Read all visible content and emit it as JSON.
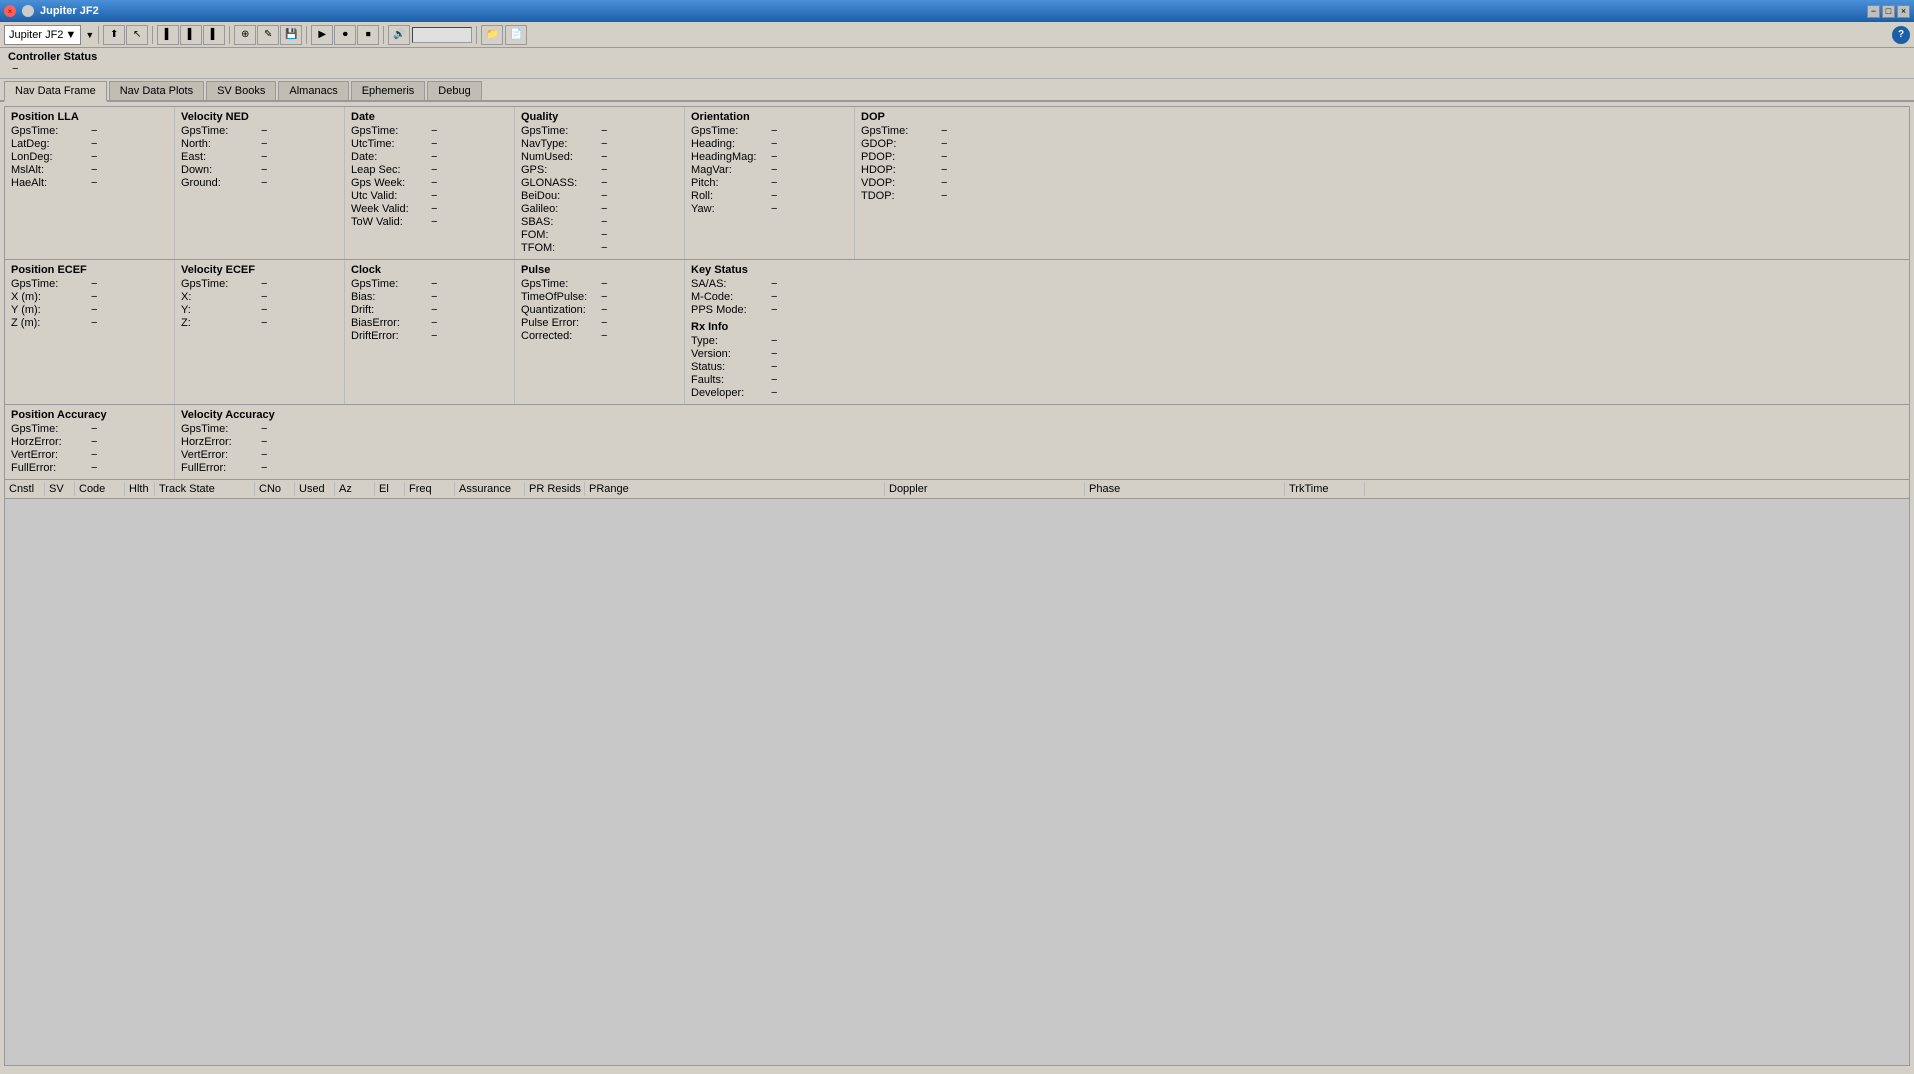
{
  "window": {
    "title": "Jupiter JF2",
    "close_label": "×",
    "minimize_label": "−",
    "maximize_label": "□"
  },
  "device": {
    "name": "Jupiter JF2",
    "dropdown_arrow": "▼"
  },
  "toolbar": {
    "help": "?"
  },
  "controller_status": {
    "label": "Controller Status",
    "value": "−"
  },
  "tabs": [
    {
      "label": "Nav Data Frame",
      "active": true
    },
    {
      "label": "Nav Data Plots",
      "active": false
    },
    {
      "label": "SV Books",
      "active": false
    },
    {
      "label": "Almanacs",
      "active": false
    },
    {
      "label": "Ephemeris",
      "active": false
    },
    {
      "label": "Debug",
      "active": false
    }
  ],
  "panels": {
    "position_lla": {
      "title": "Position LLA",
      "fields": [
        {
          "label": "GpsTime:",
          "value": "−"
        },
        {
          "label": "LatDeg:",
          "value": "−"
        },
        {
          "label": "LonDeg:",
          "value": "−"
        },
        {
          "label": "MslAlt:",
          "value": "−"
        },
        {
          "label": "HaeAlt:",
          "value": "−"
        }
      ]
    },
    "velocity_ned": {
      "title": "Velocity NED",
      "fields": [
        {
          "label": "GpsTime:",
          "value": "−"
        },
        {
          "label": "North:",
          "value": "−"
        },
        {
          "label": "East:",
          "value": "−"
        },
        {
          "label": "Down:",
          "value": "−"
        },
        {
          "label": "Ground:",
          "value": "−"
        }
      ]
    },
    "date": {
      "title": "Date",
      "fields": [
        {
          "label": "GpsTime:",
          "value": "−"
        },
        {
          "label": "UtcTime:",
          "value": "−"
        },
        {
          "label": "Date:",
          "value": "−"
        },
        {
          "label": "Leap Sec:",
          "value": "−"
        },
        {
          "label": "Gps Week:",
          "value": "−"
        },
        {
          "label": "Utc Valid:",
          "value": "−"
        },
        {
          "label": "Week Valid:",
          "value": "−"
        },
        {
          "label": "ToW Valid:",
          "value": "−"
        }
      ]
    },
    "quality": {
      "title": "Quality",
      "fields": [
        {
          "label": "GpsTime:",
          "value": "−"
        },
        {
          "label": "NavType:",
          "value": "−"
        },
        {
          "label": "NumUsed:",
          "value": "−"
        },
        {
          "label": "GPS:",
          "value": "−"
        },
        {
          "label": "GLONASS:",
          "value": "−"
        },
        {
          "label": "BeiDou:",
          "value": "−"
        },
        {
          "label": "Galileo:",
          "value": "−"
        },
        {
          "label": "SBAS:",
          "value": "−"
        },
        {
          "label": "FOM:",
          "value": "−"
        },
        {
          "label": "TFOM:",
          "value": "−"
        }
      ]
    },
    "orientation": {
      "title": "Orientation",
      "fields": [
        {
          "label": "GpsTime:",
          "value": "−"
        },
        {
          "label": "Heading:",
          "value": "−"
        },
        {
          "label": "HeadingMag:",
          "value": "−"
        },
        {
          "label": "MagVar:",
          "value": "−"
        },
        {
          "label": "Pitch:",
          "value": "−"
        },
        {
          "label": "Roll:",
          "value": "−"
        },
        {
          "label": "Yaw:",
          "value": "−"
        }
      ]
    },
    "dop": {
      "title": "DOP",
      "fields": [
        {
          "label": "GpsTime:",
          "value": "−"
        },
        {
          "label": "GDOP:",
          "value": "−"
        },
        {
          "label": "PDOP:",
          "value": "−"
        },
        {
          "label": "HDOP:",
          "value": "−"
        },
        {
          "label": "VDOP:",
          "value": "−"
        },
        {
          "label": "TDOP:",
          "value": "−"
        }
      ]
    },
    "position_ecef": {
      "title": "Position ECEF",
      "fields": [
        {
          "label": "GpsTime:",
          "value": "−"
        },
        {
          "label": "X (m):",
          "value": "−"
        },
        {
          "label": "Y (m):",
          "value": "−"
        },
        {
          "label": "Z (m):",
          "value": "−"
        }
      ]
    },
    "velocity_ecef": {
      "title": "Velocity ECEF",
      "fields": [
        {
          "label": "GpsTime:",
          "value": "−"
        },
        {
          "label": "X:",
          "value": "−"
        },
        {
          "label": "Y:",
          "value": "−"
        },
        {
          "label": "Z:",
          "value": "−"
        }
      ]
    },
    "clock": {
      "title": "Clock",
      "fields": [
        {
          "label": "GpsTime:",
          "value": "−"
        },
        {
          "label": "Bias:",
          "value": "−"
        },
        {
          "label": "Drift:",
          "value": "−"
        },
        {
          "label": "BiasError:",
          "value": "−"
        },
        {
          "label": "DriftError:",
          "value": "−"
        }
      ]
    },
    "pulse": {
      "title": "Pulse",
      "fields": [
        {
          "label": "GpsTime:",
          "value": "−"
        },
        {
          "label": "TimeOfPulse:",
          "value": "−"
        },
        {
          "label": "Quantization:",
          "value": "−"
        },
        {
          "label": "Pulse Error:",
          "value": "−"
        },
        {
          "label": "Corrected:",
          "value": "−"
        }
      ]
    },
    "key_status": {
      "title": "Key Status",
      "fields": [
        {
          "label": "SA/AS:",
          "value": "−"
        },
        {
          "label": "M-Code:",
          "value": "−"
        },
        {
          "label": "PPS Mode:",
          "value": "−"
        }
      ]
    },
    "rx_info": {
      "title": "Rx Info",
      "fields": [
        {
          "label": "Type:",
          "value": "−"
        },
        {
          "label": "Version:",
          "value": "−"
        },
        {
          "label": "Status:",
          "value": "−"
        },
        {
          "label": "Faults:",
          "value": "−"
        },
        {
          "label": "Developer:",
          "value": "−"
        }
      ]
    },
    "position_accuracy": {
      "title": "Position Accuracy",
      "fields": [
        {
          "label": "GpsTime:",
          "value": "−"
        },
        {
          "label": "HorzError:",
          "value": "−"
        },
        {
          "label": "VertError:",
          "value": "−"
        },
        {
          "label": "FullError:",
          "value": "−"
        }
      ]
    },
    "velocity_accuracy": {
      "title": "Velocity Accuracy",
      "fields": [
        {
          "label": "GpsTime:",
          "value": "−"
        },
        {
          "label": "HorzError:",
          "value": "−"
        },
        {
          "label": "VertError:",
          "value": "−"
        },
        {
          "label": "FullError:",
          "value": "−"
        }
      ]
    }
  },
  "table": {
    "columns": [
      {
        "label": "Cnstl",
        "key": "cnstl"
      },
      {
        "label": "SV",
        "key": "sv"
      },
      {
        "label": "Code",
        "key": "code"
      },
      {
        "label": "Hlth",
        "key": "hlth"
      },
      {
        "label": "Track State",
        "key": "track_state"
      },
      {
        "label": "CNo",
        "key": "cno"
      },
      {
        "label": "Used",
        "key": "used"
      },
      {
        "label": "Az",
        "key": "az"
      },
      {
        "label": "El",
        "key": "el"
      },
      {
        "label": "Freq",
        "key": "freq"
      },
      {
        "label": "Assurance",
        "key": "assurance"
      },
      {
        "label": "PR Resids",
        "key": "pr_resids"
      },
      {
        "label": "PRange",
        "key": "prange"
      },
      {
        "label": "Doppler",
        "key": "doppler"
      },
      {
        "label": "Phase",
        "key": "phase"
      },
      {
        "label": "TrkTime",
        "key": "trktime"
      }
    ],
    "rows": []
  }
}
